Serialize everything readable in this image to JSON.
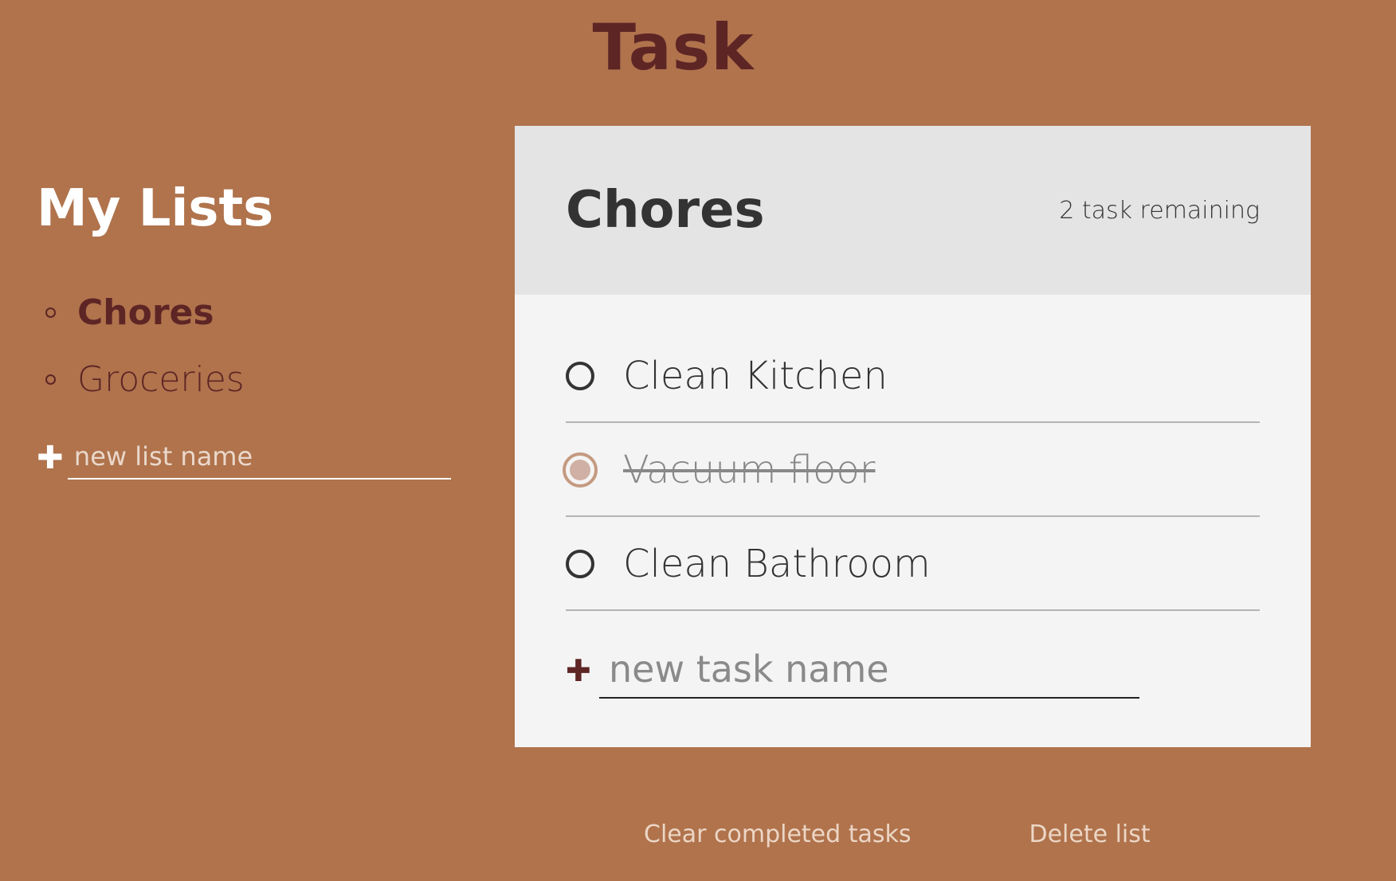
{
  "app": {
    "title": "Task"
  },
  "sidebar": {
    "title": "My Lists",
    "lists": [
      {
        "label": "Chores",
        "active": true
      },
      {
        "label": "Groceries",
        "active": false
      }
    ],
    "new_list_placeholder": "new list name"
  },
  "panel": {
    "title": "Chores",
    "remaining": "2 task remaining",
    "tasks": [
      {
        "label": "Clean Kitchen",
        "completed": false
      },
      {
        "label": "Vacuum floor",
        "completed": true
      },
      {
        "label": "Clean Bathroom",
        "completed": false
      }
    ],
    "new_task_placeholder": "new task name"
  },
  "actions": {
    "clear_completed": "Clear completed tasks",
    "delete_list": "Delete list"
  },
  "colors": {
    "background": "#b0734c",
    "accent": "#5e2525",
    "panel": "#f4f4f4",
    "panel_header": "#e4e4e4"
  },
  "icons": {
    "add_list": "plus-icon",
    "add_task": "plus-icon"
  }
}
